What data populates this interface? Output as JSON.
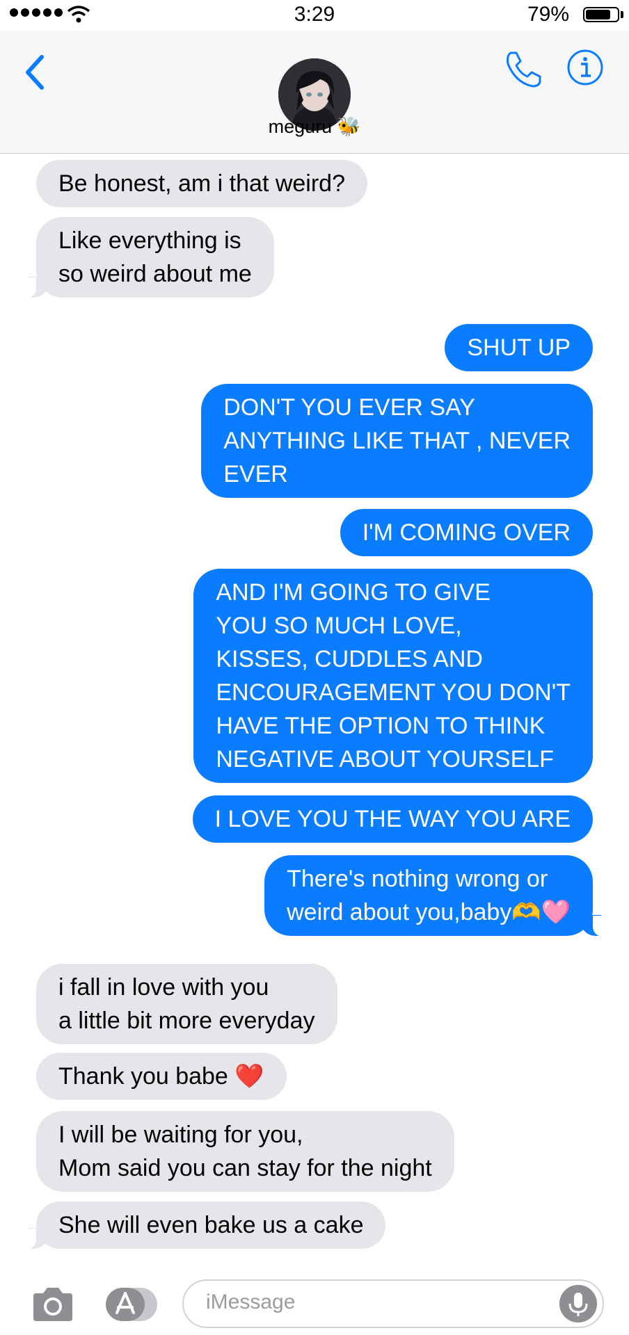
{
  "status_bar": {
    "time": "3:29",
    "battery": "79%",
    "battery_level": 0.79
  },
  "header": {
    "contact_name": "meguru 🐝",
    "avatar": "avatar-photo",
    "icons": [
      "back-chevron-icon",
      "phone-icon",
      "info-icon"
    ]
  },
  "colors": {
    "accent": "#0a7cff",
    "incoming_bubble": "#e5e5ea",
    "header_bg": "#f7f7f7"
  },
  "messages": [
    {
      "dir": "in",
      "text": "Be honest, am i that weird?"
    },
    {
      "dir": "in",
      "text": "Like everything is\nso weird about me"
    },
    {
      "dir": "out",
      "text": "SHUT UP"
    },
    {
      "dir": "out",
      "text": "DON'T YOU EVER SAY\nANYTHING LIKE THAT , NEVER\nEVER"
    },
    {
      "dir": "out",
      "text": "I'M COMING OVER"
    },
    {
      "dir": "out",
      "text": "AND I'M GOING TO GIVE\nYOU SO MUCH LOVE,\nKISSES, CUDDLES AND\nENCOURAGEMENT YOU DON'T\nHAVE THE OPTION TO THINK\nNEGATIVE ABOUT YOURSELF"
    },
    {
      "dir": "out",
      "text": "I LOVE YOU THE WAY YOU ARE"
    },
    {
      "dir": "out",
      "text": "There's nothing wrong or\nweird about you,baby🫶🩷"
    },
    {
      "dir": "in",
      "text": "i fall in love with you\na little bit more everyday"
    },
    {
      "dir": "in",
      "text": "Thank you babe ❤️"
    },
    {
      "dir": "in",
      "text": "I will be waiting for you,\nMom said you can stay for the night"
    },
    {
      "dir": "in",
      "text": "She will even bake us a cake"
    }
  ],
  "input": {
    "placeholder": "iMessage",
    "icons": [
      "camera-icon",
      "app-store-icon",
      "microphone-icon"
    ]
  }
}
